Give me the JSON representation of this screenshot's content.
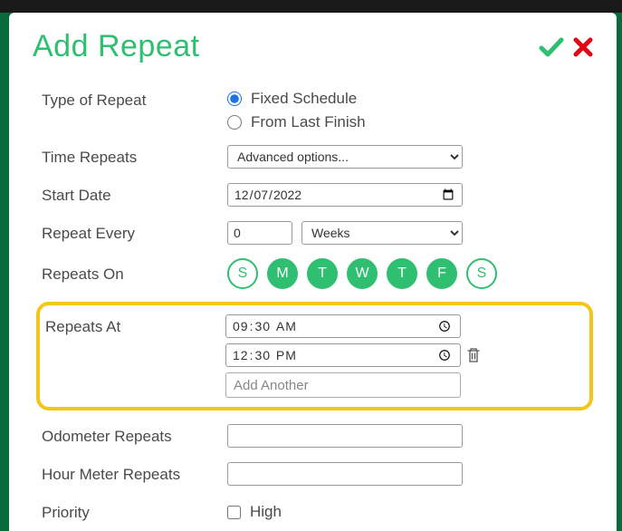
{
  "header": {
    "title": "Add Repeat"
  },
  "labels": {
    "type_of_repeat": "Type of Repeat",
    "time_repeats": "Time Repeats",
    "start_date": "Start Date",
    "repeat_every": "Repeat Every",
    "repeats_on": "Repeats On",
    "repeats_at": "Repeats At",
    "odometer_repeats": "Odometer Repeats",
    "hour_meter_repeats": "Hour Meter Repeats",
    "priority": "Priority"
  },
  "type_options": {
    "fixed": "Fixed Schedule",
    "from_last": "From Last Finish",
    "selected": "fixed"
  },
  "time_repeats": {
    "selected_label": "Advanced options..."
  },
  "start_date": {
    "value": "2022-12-07",
    "display": "12/07/2022"
  },
  "repeat_every": {
    "count": "0",
    "unit_label": "Weeks"
  },
  "days": [
    {
      "letter": "S",
      "active": false
    },
    {
      "letter": "M",
      "active": true
    },
    {
      "letter": "T",
      "active": true
    },
    {
      "letter": "W",
      "active": true
    },
    {
      "letter": "T",
      "active": true
    },
    {
      "letter": "F",
      "active": true
    },
    {
      "letter": "S",
      "active": false
    }
  ],
  "repeats_at": {
    "times": [
      {
        "display": "09:30 AM",
        "value": "09:30",
        "deletable": false
      },
      {
        "display": "12:30 PM",
        "value": "12:30",
        "deletable": true
      }
    ],
    "add_placeholder": "Add Another"
  },
  "odometer_repeats": {
    "value": ""
  },
  "hour_meter_repeats": {
    "value": ""
  },
  "priority": {
    "high_label": "High",
    "high_checked": false
  },
  "icons": {
    "confirm": "check-icon",
    "cancel": "close-icon",
    "trash": "trash-icon"
  },
  "colors": {
    "accent": "#2fbf71",
    "danger": "#e30613",
    "highlight": "#f5c518"
  }
}
